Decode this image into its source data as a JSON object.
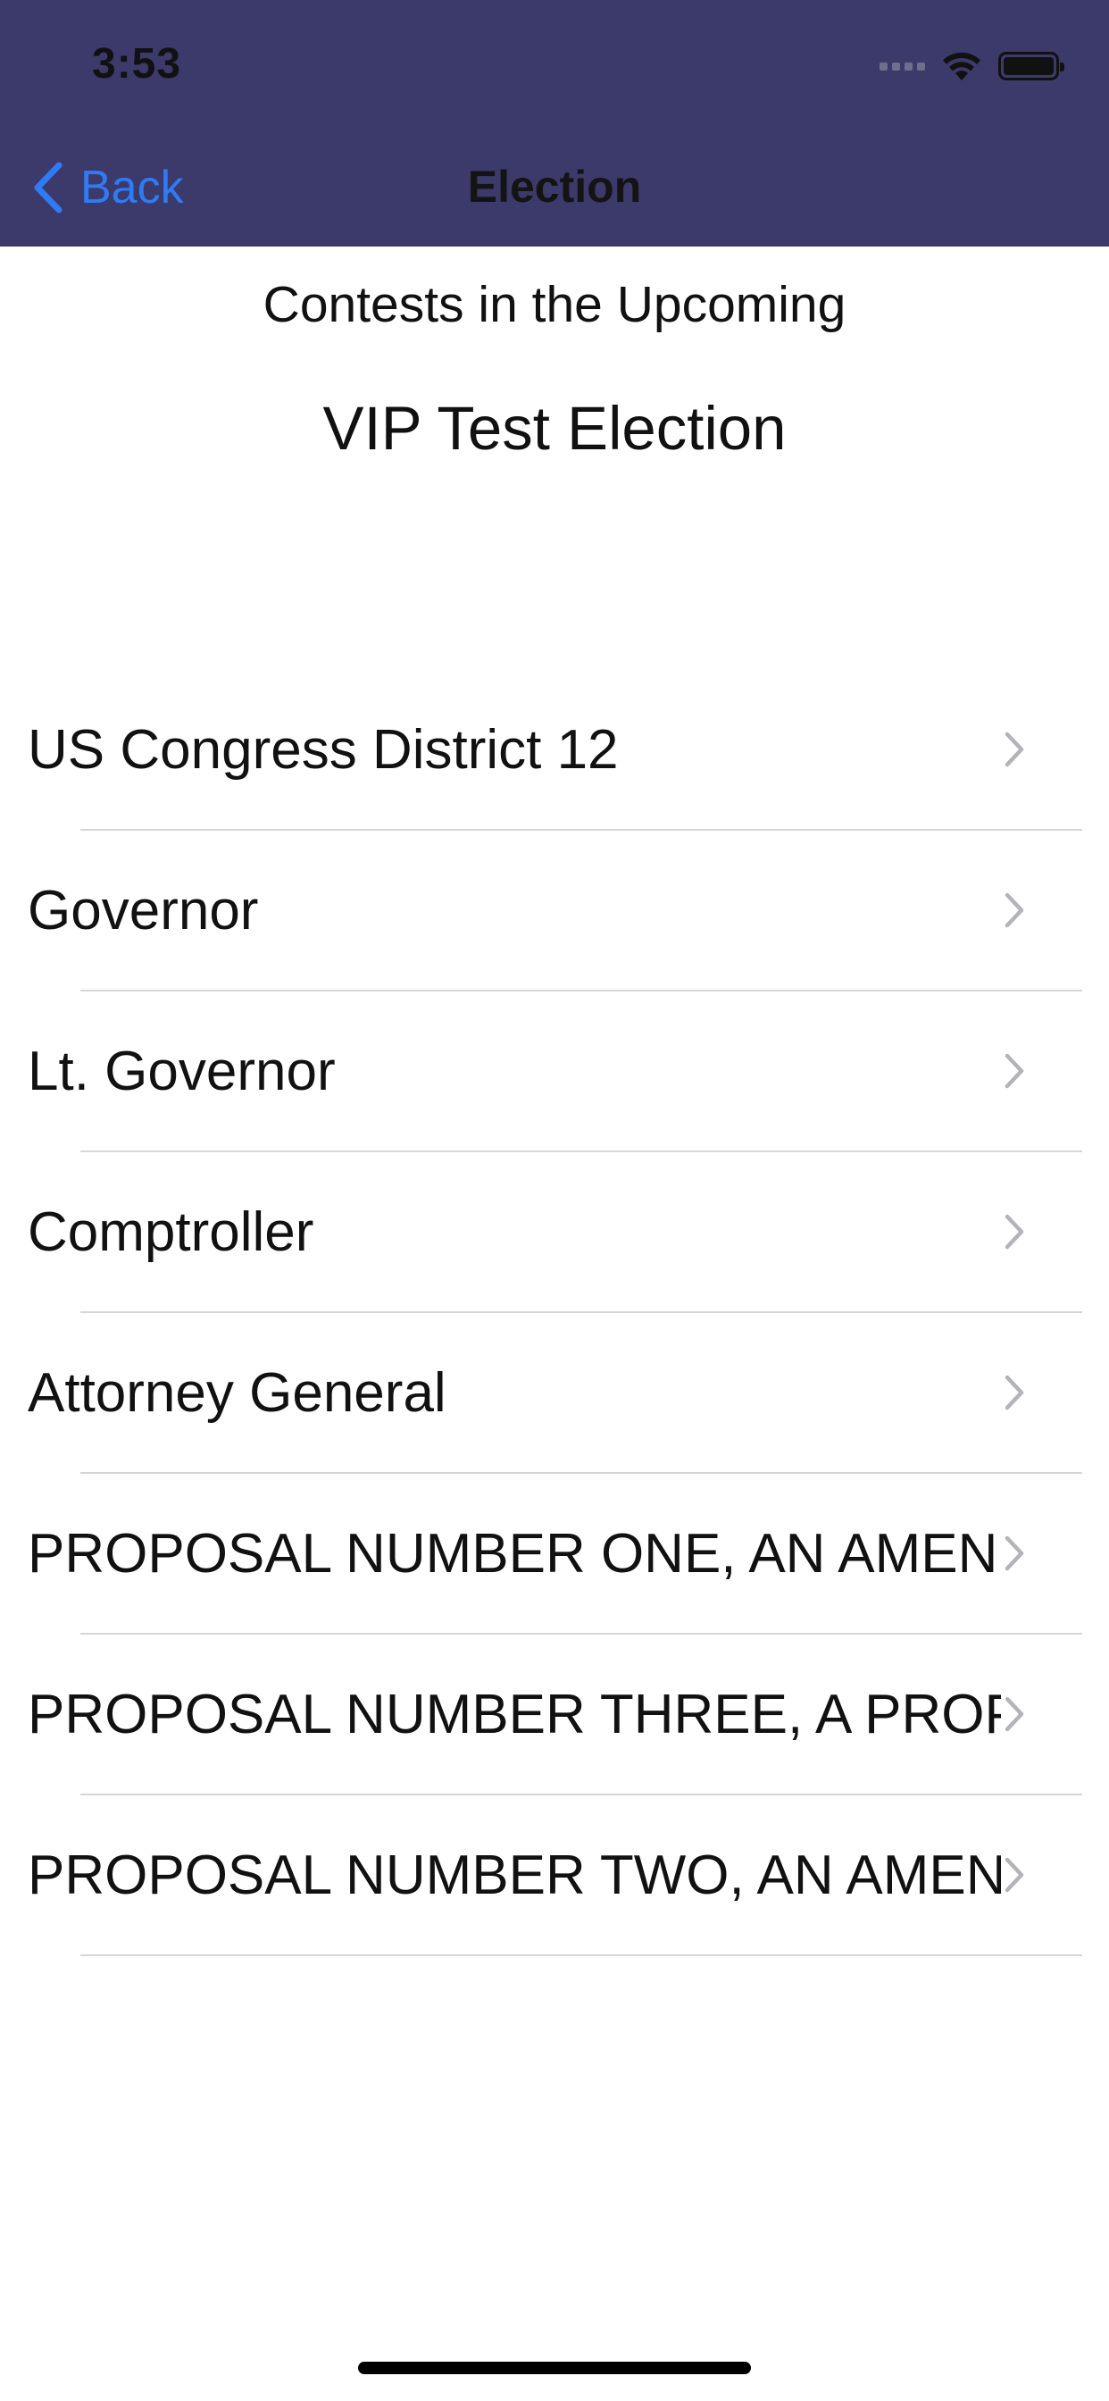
{
  "status_bar": {
    "time": "3:53",
    "icons": [
      "signal-icon",
      "wifi-icon",
      "battery-icon"
    ]
  },
  "nav": {
    "back_label": "Back",
    "title": "Election"
  },
  "header": {
    "subtitle": "Contests in the Upcoming",
    "election_name": "VIP Test Election"
  },
  "contests": [
    {
      "label": "US Congress District 12"
    },
    {
      "label": "Governor"
    },
    {
      "label": "Lt. Governor"
    },
    {
      "label": "Comptroller"
    },
    {
      "label": "Attorney General"
    },
    {
      "label": "PROPOSAL NUMBER ONE, AN AMENI"
    },
    {
      "label": "PROPOSAL NUMBER THREE, A PROPO"
    },
    {
      "label": "PROPOSAL NUMBER TWO, AN AMEN"
    }
  ],
  "colors": {
    "nav_background": "#3b3a6b",
    "accent": "#2f7bf6",
    "divider": "#d6d6d9",
    "chevron": "#b3b3b8"
  }
}
